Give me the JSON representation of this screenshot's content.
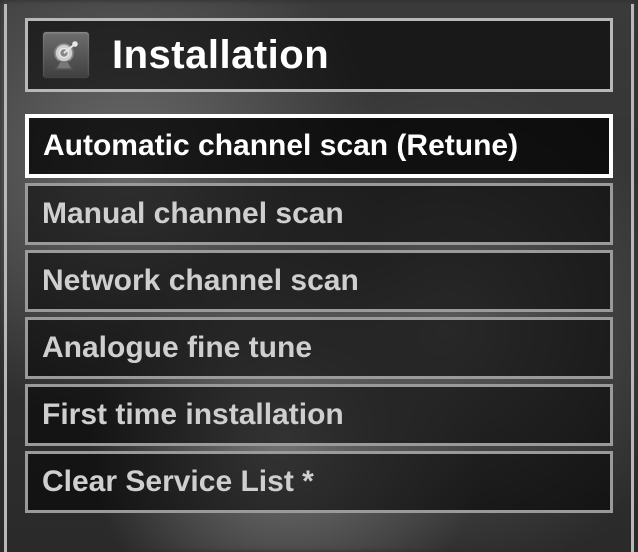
{
  "header": {
    "title": "Installation",
    "icon": "dish-icon"
  },
  "menu": {
    "items": [
      {
        "label": "Automatic channel scan (Retune)",
        "selected": true
      },
      {
        "label": "Manual channel scan",
        "selected": false
      },
      {
        "label": "Network channel scan",
        "selected": false
      },
      {
        "label": "Analogue fine tune",
        "selected": false
      },
      {
        "label": "First time installation",
        "selected": false
      },
      {
        "label": "Clear Service List *",
        "selected": false
      }
    ]
  },
  "colors": {
    "border": "#b8b8b8",
    "border_dim": "#9a9a9a",
    "text": "#ffffff",
    "text_dim": "#cfcfcf"
  }
}
